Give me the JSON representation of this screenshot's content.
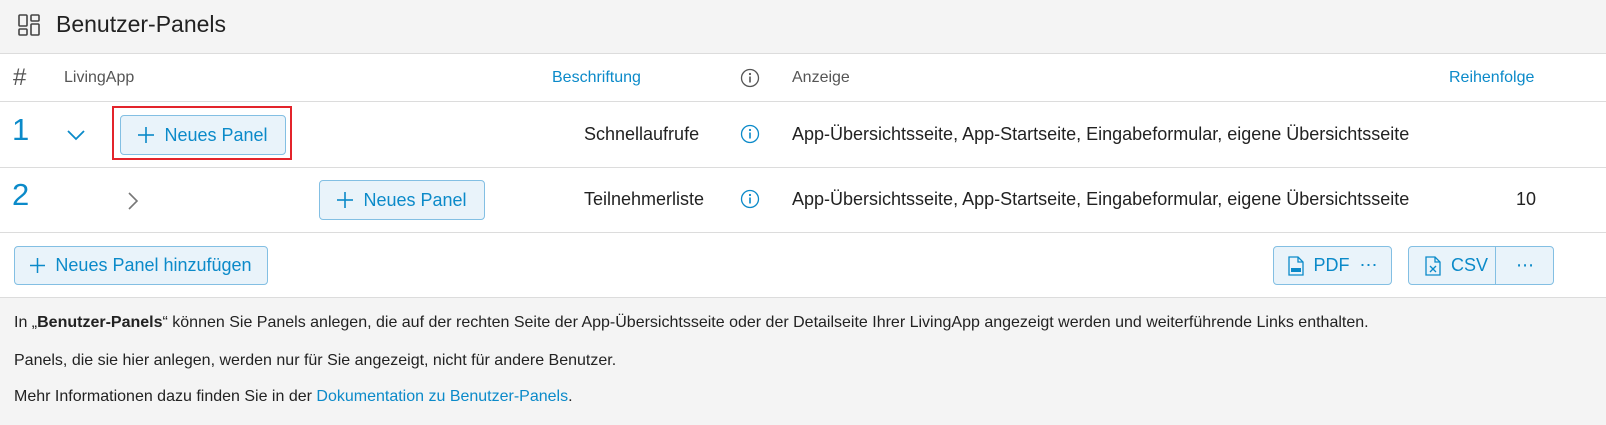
{
  "header": {
    "title": "Benutzer-Panels",
    "icon": "grid-icon"
  },
  "table": {
    "columns": {
      "number": "#",
      "livingapp": "LivingApp",
      "beschriftung": "Beschriftung",
      "anzeige": "Anzeige",
      "reihenfolge": "Reihenfolge"
    },
    "rows": [
      {
        "number": "1",
        "new_panel_label": "Neues Panel",
        "beschriftung": "Schnellaufrufe",
        "anzeige": "App-Übersichtsseite, App-Startseite, Eingabeformular, eigene Übersichtsseite",
        "reihenfolge": ""
      },
      {
        "number": "2",
        "new_panel_label": "Neues Panel",
        "beschriftung": "Teilnehmerliste",
        "anzeige": "App-Übersichtsseite, App-Startseite, Eingabeformular, eigene Übersichtsseite",
        "reihenfolge": "10"
      }
    ]
  },
  "toolbar": {
    "add_panel_label": "Neues Panel hinzufügen",
    "pdf_label": "PDF",
    "pdf_more": "⋯",
    "csv_label": "CSV",
    "more_label": "⋯"
  },
  "footer": {
    "p1_before": "In „",
    "p1_bold": "Benutzer-Panels",
    "p1_after": "“ können Sie Panels anlegen, die auf der rechten Seite der App-Übersichtsseite oder der Detailseite Ihrer LivingApp angezeigt werden und weiterführende Links enthalten.",
    "p2": "Panels, die sie hier anlegen, werden nur für Sie angezeigt, nicht für andere Benutzer.",
    "p3_before": "Mehr Informationen dazu finden Sie in der ",
    "p3_link": "Dokumentation zu Benutzer-Panels",
    "p3_after": "."
  },
  "colors": {
    "accent": "#0b8ac9",
    "button_bg": "#e9f3fa",
    "highlight": "#e3242b"
  }
}
